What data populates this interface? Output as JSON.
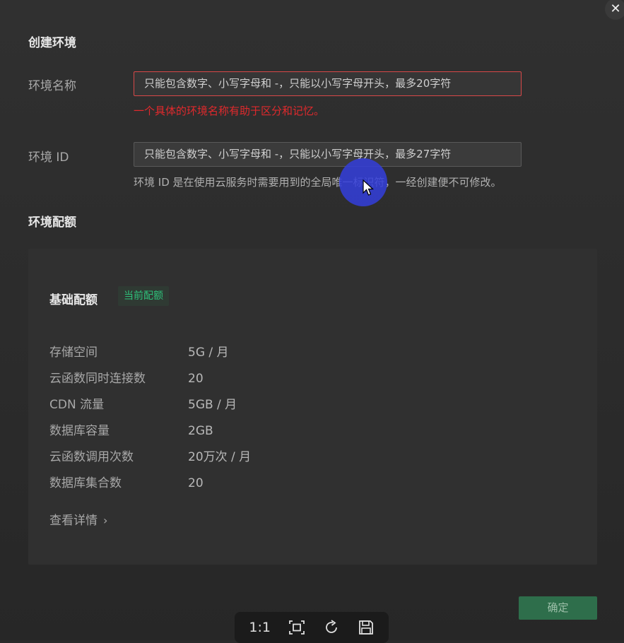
{
  "dialog": {
    "close_glyph": "✕",
    "title": "创建环境",
    "env_name": {
      "label": "环境名称",
      "placeholder": "只能包含数字、小写字母和 -，只能以小写字母开头，最多20字符",
      "error": "一个具体的环境名称有助于区分和记忆。"
    },
    "env_id": {
      "label": "环境 ID",
      "placeholder": "只能包含数字、小写字母和 -，只能以小写字母开头，最多27字符",
      "hint": "环境 ID 是在使用云服务时需要用到的全局唯一标识符，一经创建便不可修改。"
    },
    "quota": {
      "section_title": "环境配额",
      "plan_name": "基础配额",
      "badge": "当前配额",
      "rows": [
        {
          "key": "存储空间",
          "value": "5G / 月"
        },
        {
          "key": "云函数同时连接数",
          "value": "20"
        },
        {
          "key": "CDN 流量",
          "value": "5GB / 月"
        },
        {
          "key": "数据库容量",
          "value": "2GB"
        },
        {
          "key": "云函数调用次数",
          "value": "20万次 / 月"
        },
        {
          "key": "数据库集合数",
          "value": "20"
        }
      ],
      "details_link": "查看详情",
      "details_chevron": "›"
    },
    "confirm_label": "确定"
  },
  "viewer_toolbar": {
    "actual_size_label": "1:1",
    "tools": [
      "actual-size-icon",
      "fit-screen-icon",
      "rotate-icon",
      "save-icon"
    ]
  },
  "colors": {
    "error": "#e0292c",
    "accent_green": "#2ec07a",
    "confirm_bg": "#2e6e4b",
    "cursor_highlight": "#343edc"
  }
}
